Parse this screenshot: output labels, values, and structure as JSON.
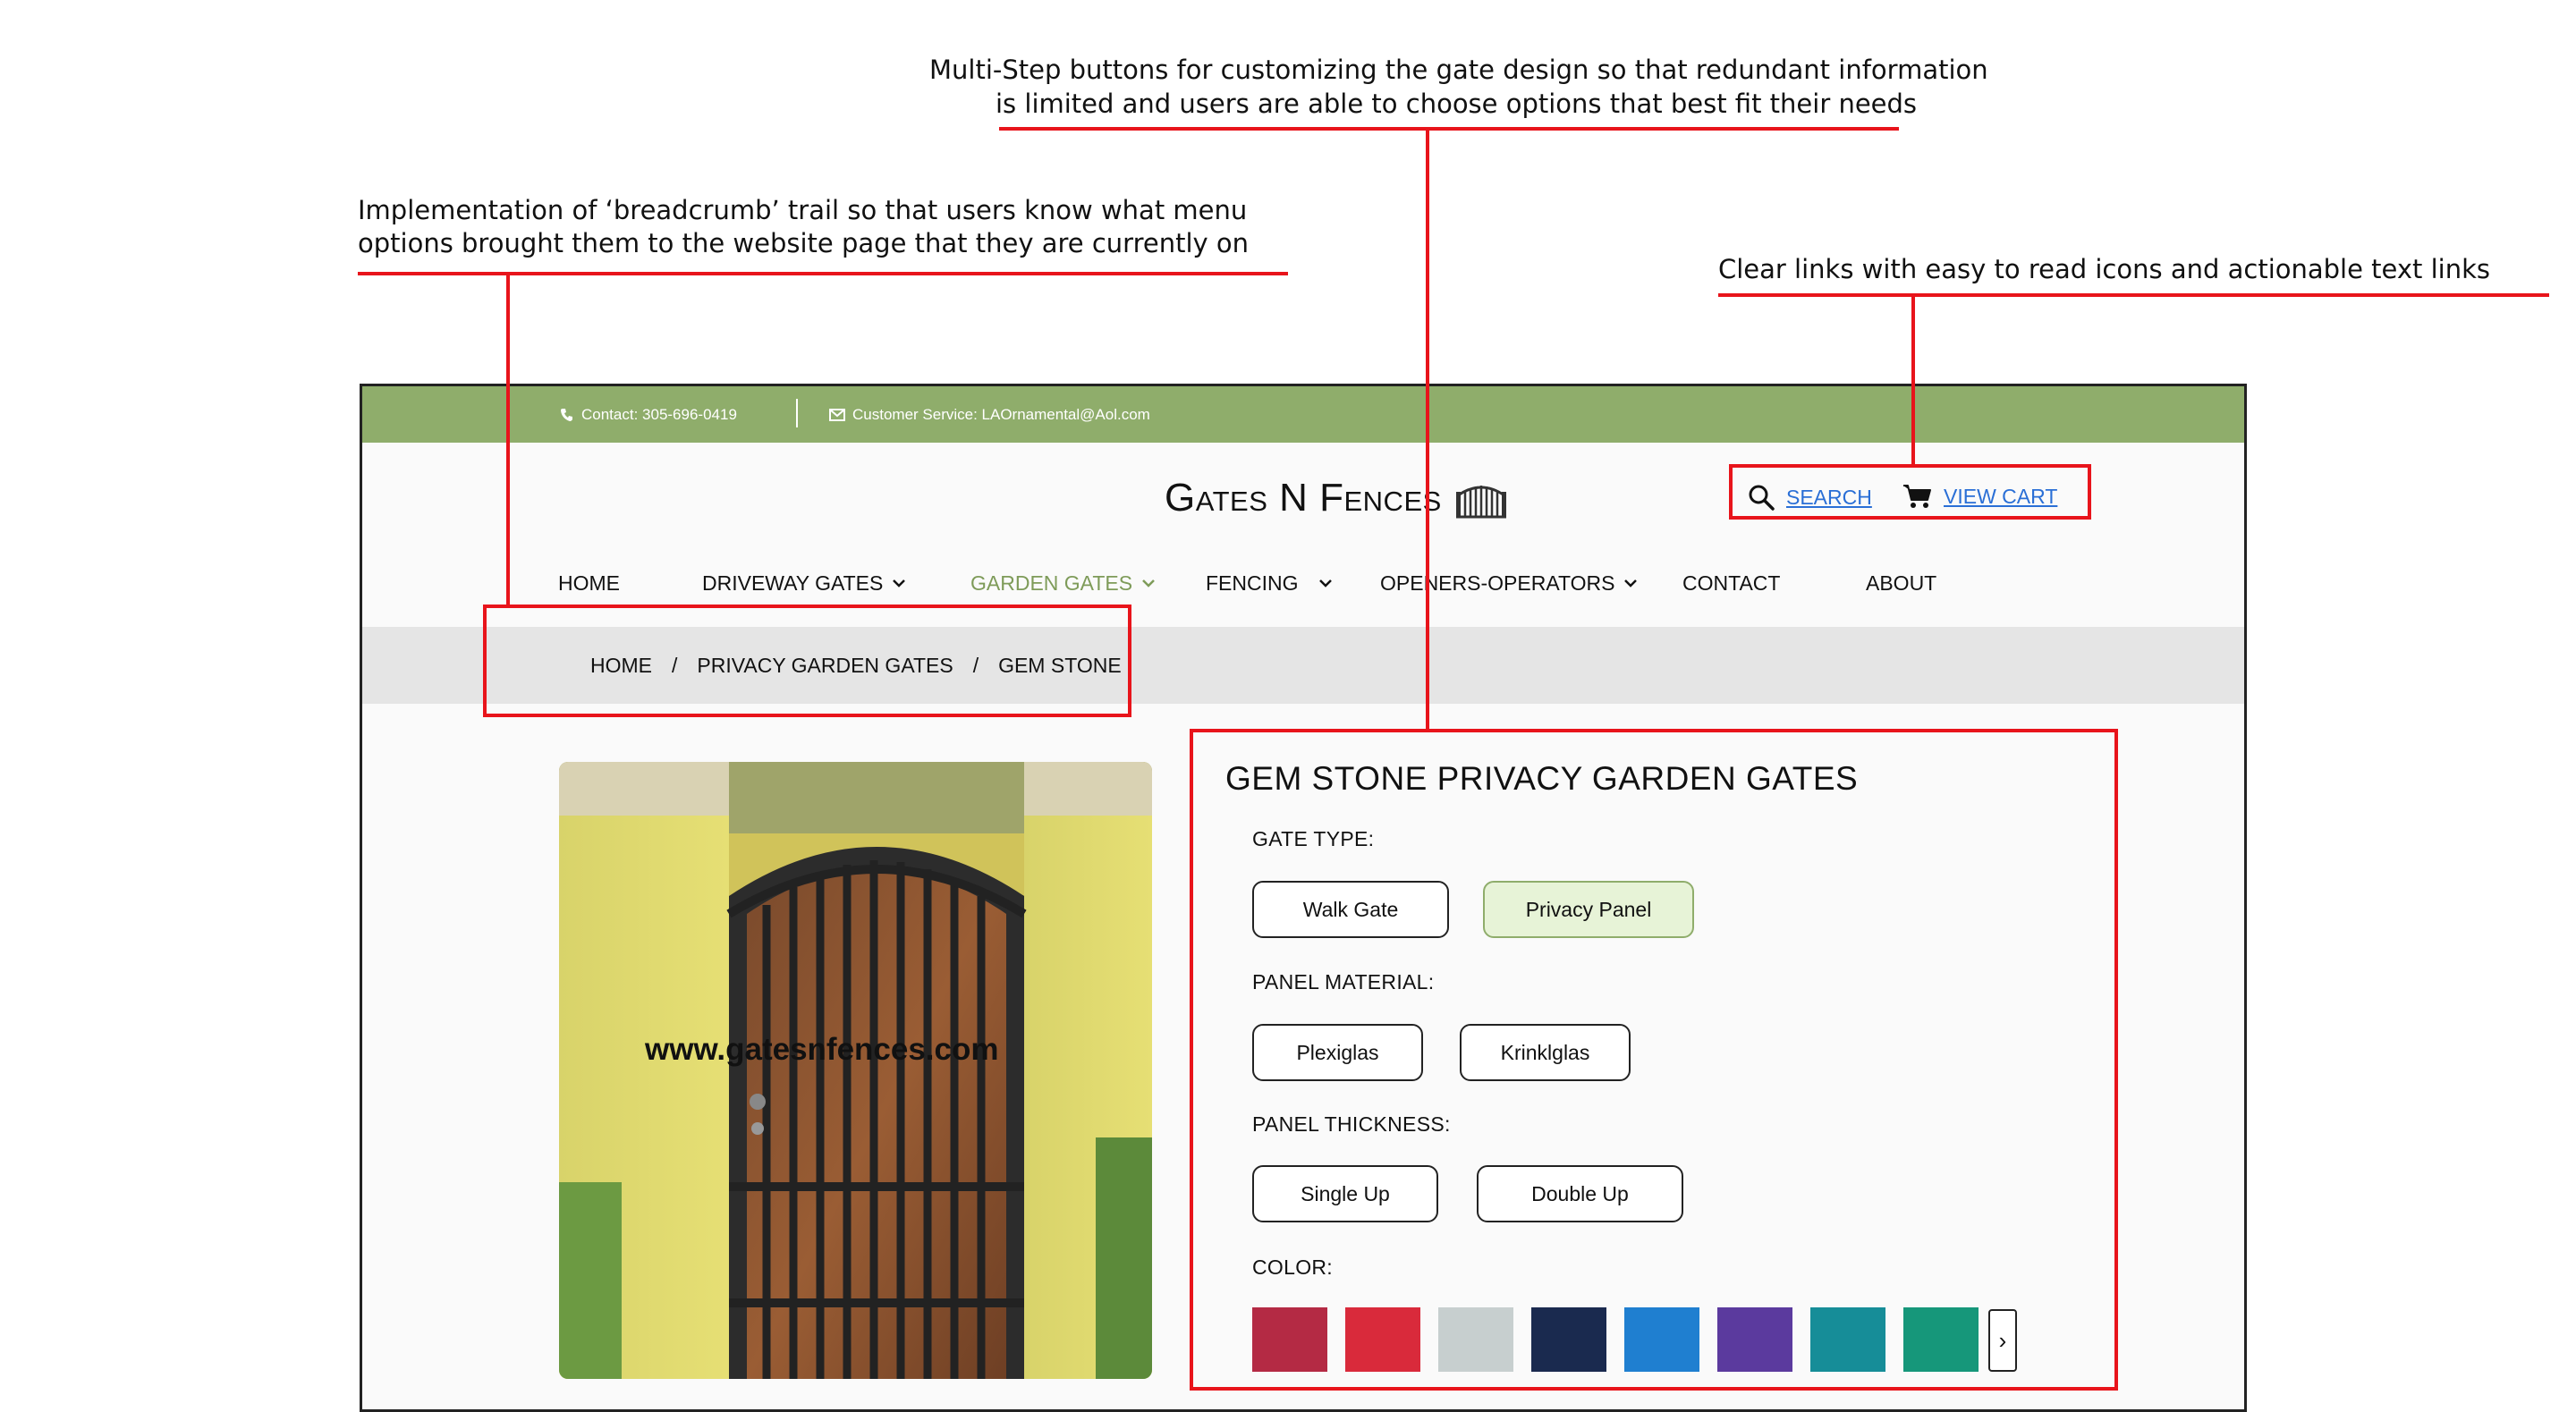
{
  "annotations": {
    "multistep_line1": "Multi-Step buttons for customizing the gate design so that redundant information",
    "multistep_line2": "is limited and users are able to choose options that best fit their needs",
    "breadcrumb_line1": "Implementation of ‘breadcrumb’ trail so that users know what menu",
    "breadcrumb_line2": "options brought them to the website page that they are currently on",
    "links_line1": "Clear links with easy to read icons and actionable text links"
  },
  "colors": {
    "top_bar": "#8fad6b",
    "accent_nav": "#7e9b59",
    "link": "#2a6fd6",
    "annotation_red": "#e8141b",
    "selected_option": "#e7f3d7"
  },
  "topbar": {
    "contact": "Contact: 305-696-0419",
    "service": "Customer Service: LAOrnamental@Aol.com"
  },
  "logo": {
    "text": "Gates N Fences",
    "icon": "gate-icon"
  },
  "utility": {
    "search": "SEARCH",
    "cart": "VIEW CART"
  },
  "nav": [
    {
      "label": "HOME"
    },
    {
      "label": "DRIVEWAY GATES"
    },
    {
      "label": "GARDEN GATES"
    },
    {
      "label": "FENCING"
    },
    {
      "label": "OPENERS-OPERATORS"
    },
    {
      "label": "CONTACT"
    },
    {
      "label": "ABOUT"
    }
  ],
  "breadcrumb": [
    "HOME",
    "PRIVACY GARDEN GATES",
    "GEM STONE"
  ],
  "breadcrumb_sep": "/",
  "product": {
    "title": "GEM STONE PRIVACY GARDEN GATES",
    "image_watermark": "www.gatesnfences.com",
    "gate_type_label": "GATE TYPE:",
    "gate_type_options": [
      "Walk Gate",
      "Privacy Panel"
    ],
    "gate_type_selected": "Privacy Panel",
    "panel_material_label": "PANEL MATERIAL:",
    "panel_material_options": [
      "Plexiglas",
      "Krinklglas"
    ],
    "panel_thickness_label": "PANEL THICKNESS:",
    "panel_thickness_options": [
      "Single Up",
      "Double Up"
    ],
    "color_label": "COLOR:",
    "color_swatches": [
      "#b42a44",
      "#d92a3b",
      "#c7cfcf",
      "#1a2a4f",
      "#1f7fd0",
      "#5b3a9e",
      "#168d98",
      "#16977a"
    ],
    "next_glyph": "›"
  }
}
